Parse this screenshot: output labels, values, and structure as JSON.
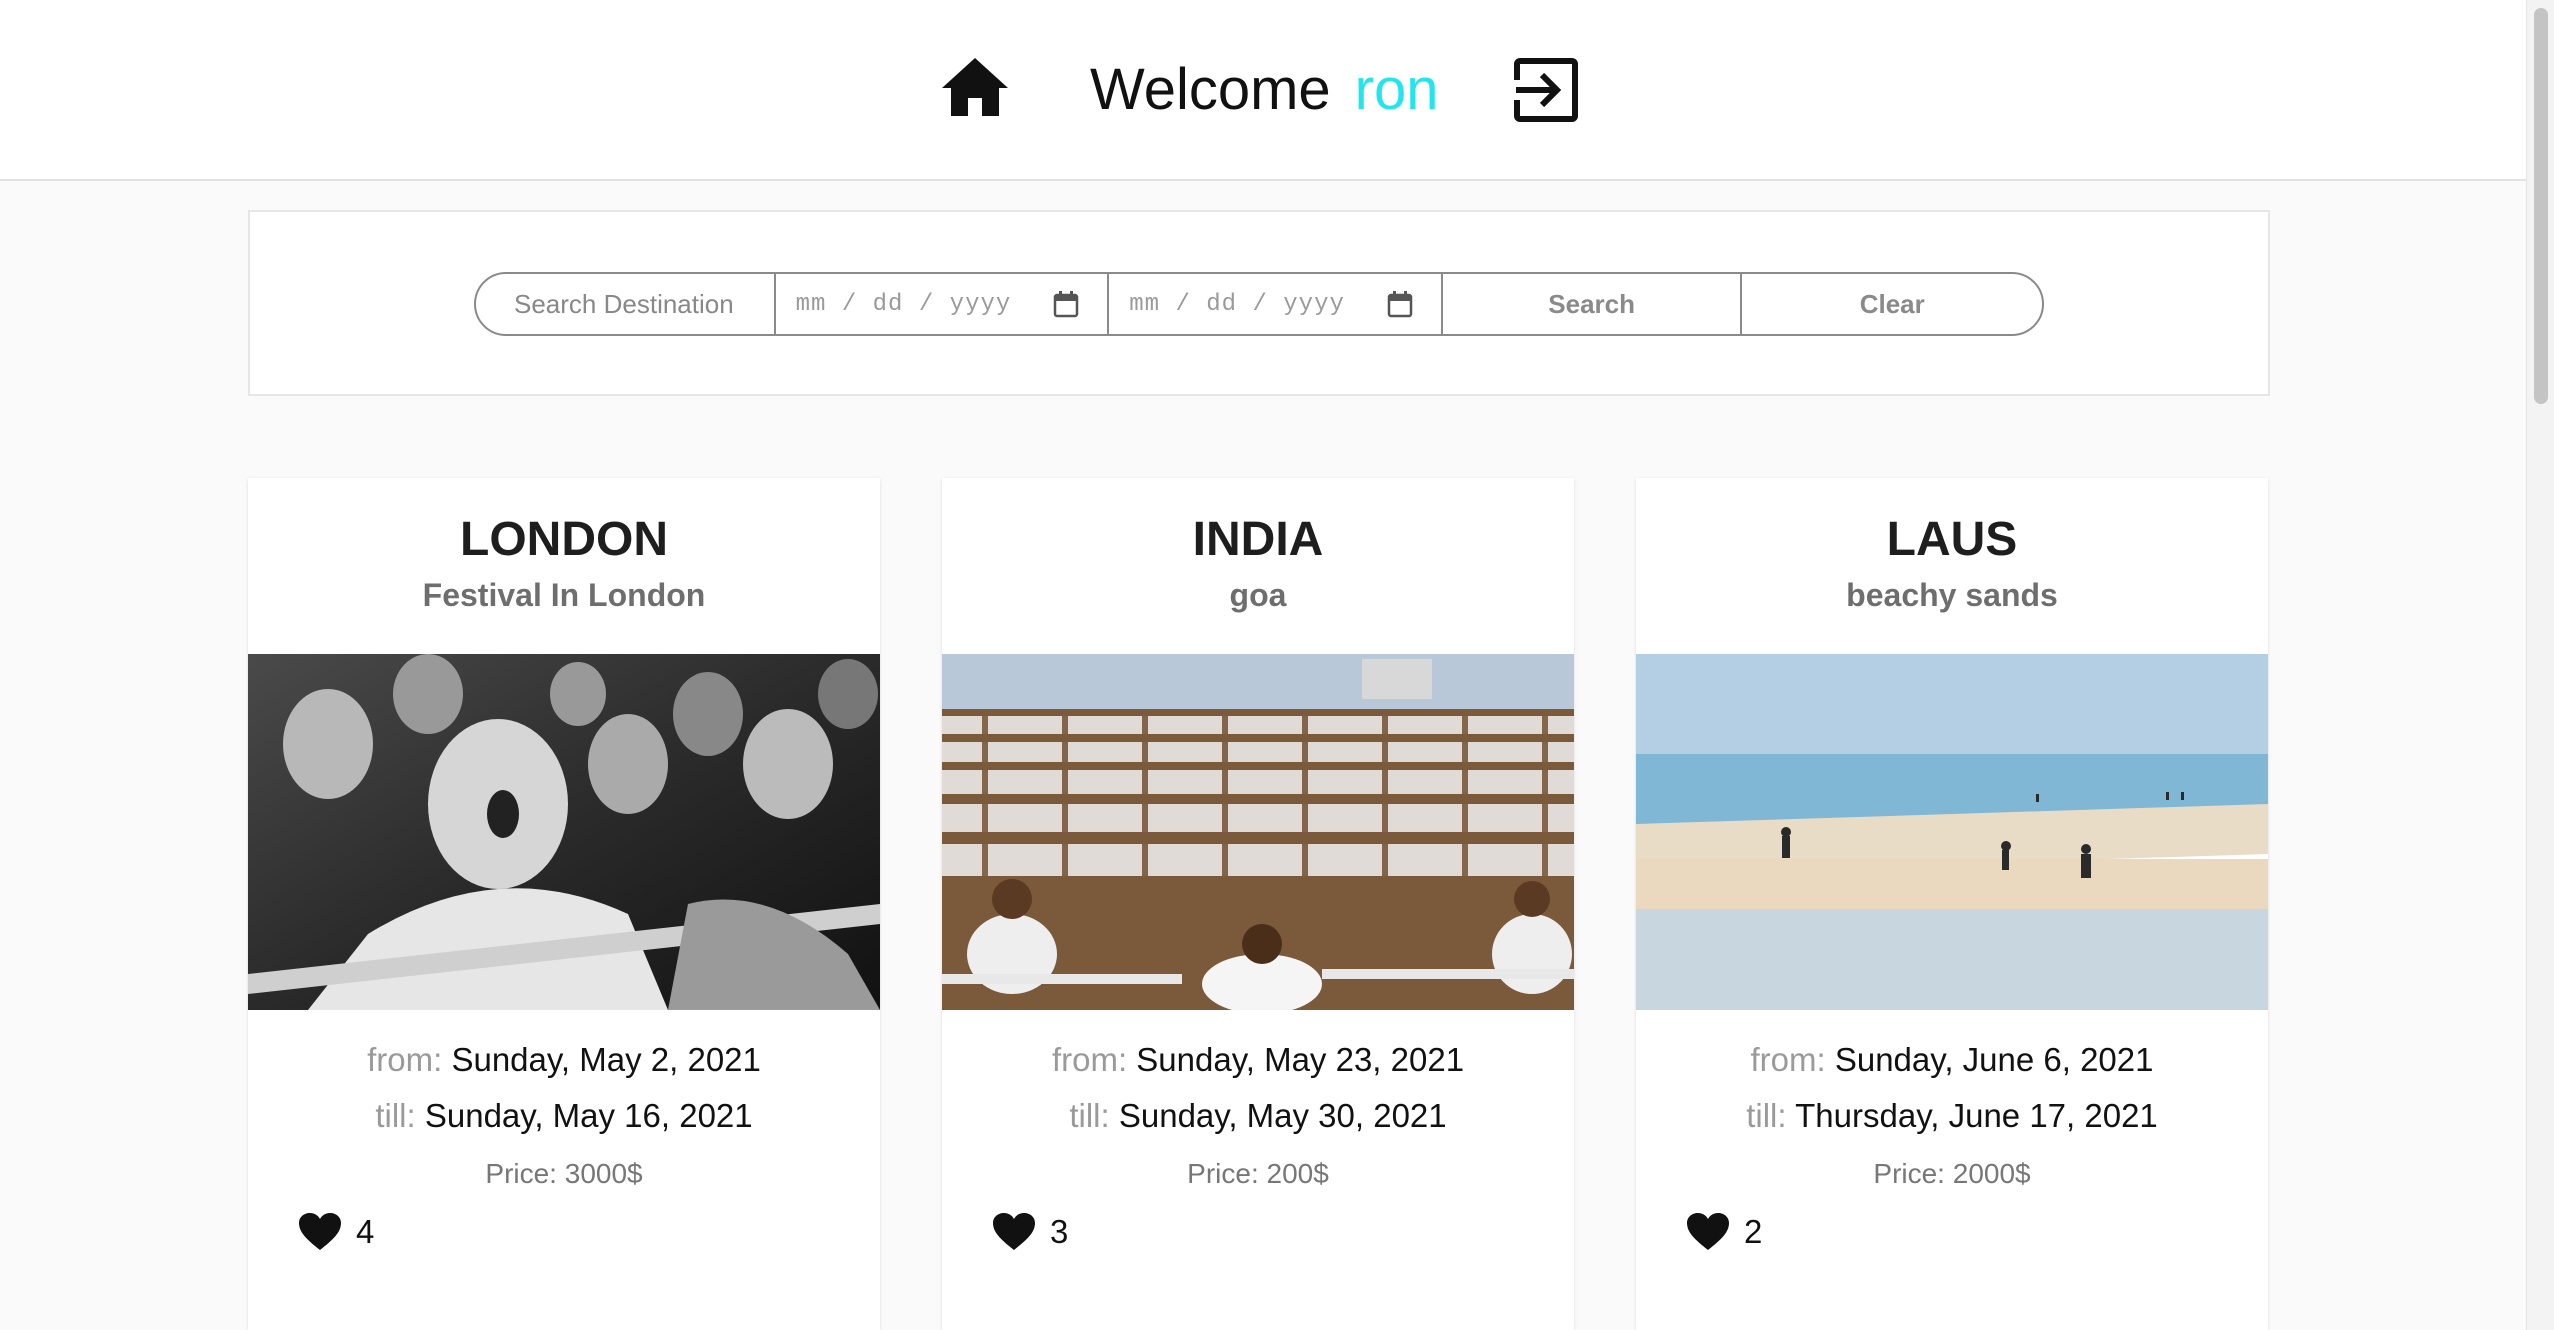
{
  "header": {
    "welcome": "Welcome",
    "username": "ron",
    "home_icon": "home-icon",
    "logout_icon": "logout-icon",
    "accent_color": "#22e5ee"
  },
  "search": {
    "destination_placeholder": "Search Destination",
    "from_date_placeholder": "mm / dd / yyyy",
    "till_date_placeholder": "mm / dd / yyyy",
    "search_label": "Search",
    "clear_label": "Clear"
  },
  "trips": [
    {
      "title": "LONDON",
      "subtitle": "Festival In London",
      "from_label": "from:",
      "from_date": "Sunday, May 2, 2021",
      "till_label": "till:",
      "till_date": "Sunday, May 16, 2021",
      "price": "Price: 3000$",
      "likes": "4"
    },
    {
      "title": "INDIA",
      "subtitle": "goa",
      "from_label": "from:",
      "from_date": "Sunday, May 23, 2021",
      "till_label": "till:",
      "till_date": "Sunday, May 30, 2021",
      "price": "Price: 200$",
      "likes": "3"
    },
    {
      "title": "LAUS",
      "subtitle": "beachy sands",
      "from_label": "from:",
      "from_date": "Sunday, June 6, 2021",
      "till_label": "till:",
      "till_date": "Thursday, June 17, 2021",
      "price": "Price: 2000$",
      "likes": "2"
    }
  ]
}
